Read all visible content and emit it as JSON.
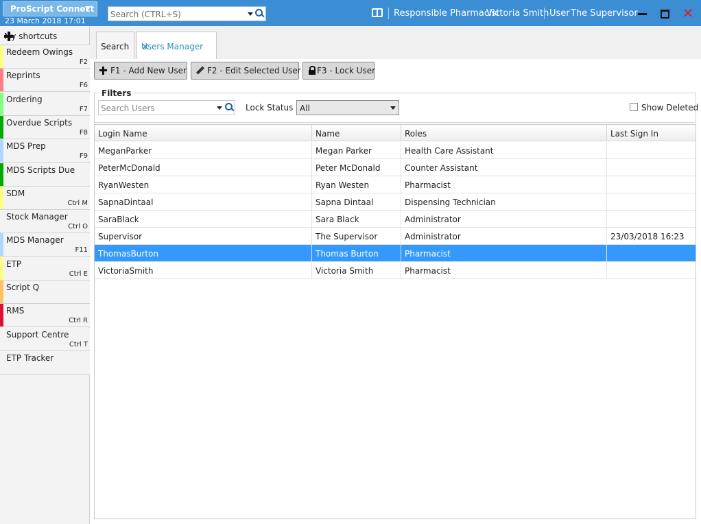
{
  "app": {
    "brand": "ProScript Connect",
    "datetime": "23 March 2018 17:01",
    "search_placeholder": "Search (CTRL+S)",
    "responsible_label": "Responsible Pharmacist",
    "responsible_name": "Victoria Smith",
    "user_label": "User",
    "user_name": "The Supervisor",
    "icons": {
      "pharmacist": "pharmacist-icon",
      "minimize": "minimize-icon",
      "maximize": "maximize-icon",
      "close": "close-icon"
    }
  },
  "sidebar": {
    "header": "My shortcuts",
    "items": [
      {
        "label": "Redeem Owings",
        "key": "F2",
        "color": "#ffff80"
      },
      {
        "label": "Reprints",
        "key": "F6",
        "color": "#ff8080"
      },
      {
        "label": "Ordering",
        "key": "F7",
        "color": "#80ff80"
      },
      {
        "label": "Overdue Scripts",
        "key": "F8",
        "color": "#00aa00"
      },
      {
        "label": "MDS Prep",
        "key": "F9",
        "color": "#b0d8ff"
      },
      {
        "label": "MDS Scripts Due",
        "key": "",
        "color": "#00aa00"
      },
      {
        "label": "SDM",
        "key": "Ctrl M",
        "color": "#ffff80"
      },
      {
        "label": "Stock Manager",
        "key": "Ctrl O",
        "color": "#f3f3f3"
      },
      {
        "label": "MDS Manager",
        "key": "F11",
        "color": "#b0d8ff"
      },
      {
        "label": "ETP",
        "key": "Ctrl E",
        "color": "#ffff80"
      },
      {
        "label": "Script Q",
        "key": "",
        "color": "#ffc060"
      },
      {
        "label": "RMS",
        "key": "Ctrl R",
        "color": "#dd1133"
      },
      {
        "label": "Support Centre",
        "key": "Ctrl T",
        "color": "#f3f3f3"
      },
      {
        "label": "ETP Tracker",
        "key": "",
        "color": "#f3f3f3"
      }
    ]
  },
  "tabs": [
    {
      "label": "Search"
    },
    {
      "label": "Users Manager"
    }
  ],
  "toolbar": {
    "add_label": "F1 -  Add New User",
    "edit_label": "F2 -  Edit Selected User",
    "lock_label": "F3 -  Lock User"
  },
  "filters": {
    "legend": "Filters",
    "search_placeholder": "Search Users",
    "lock_status_label": "Lock Status",
    "lock_status_value": "All",
    "show_deleted_label": "Show Deleted"
  },
  "grid": {
    "columns": [
      "Login Name",
      "Name",
      "Roles",
      "Last Sign In"
    ],
    "rows": [
      {
        "login": "MeganParker",
        "name": "Megan Parker",
        "role": "Health Care Assistant",
        "last": ""
      },
      {
        "login": "PeterMcDonald",
        "name": "Peter McDonald",
        "role": "Counter Assistant",
        "last": ""
      },
      {
        "login": "RyanWesten",
        "name": "Ryan Westen",
        "role": "Pharmacist",
        "last": ""
      },
      {
        "login": "SapnaDintaal",
        "name": "Sapna Dintaal",
        "role": "Dispensing Technician",
        "last": ""
      },
      {
        "login": "SaraBlack",
        "name": "Sara Black",
        "role": "Administrator",
        "last": ""
      },
      {
        "login": "Supervisor",
        "name": "The Supervisor",
        "role": "Administrator",
        "last": "23/03/2018 16:23"
      },
      {
        "login": "ThomasBurton",
        "name": "Thomas Burton",
        "role": "Pharmacist",
        "last": "",
        "selected": true
      },
      {
        "login": "VictoriaSmith",
        "name": "Victoria Smith",
        "role": "Pharmacist",
        "last": ""
      }
    ]
  }
}
